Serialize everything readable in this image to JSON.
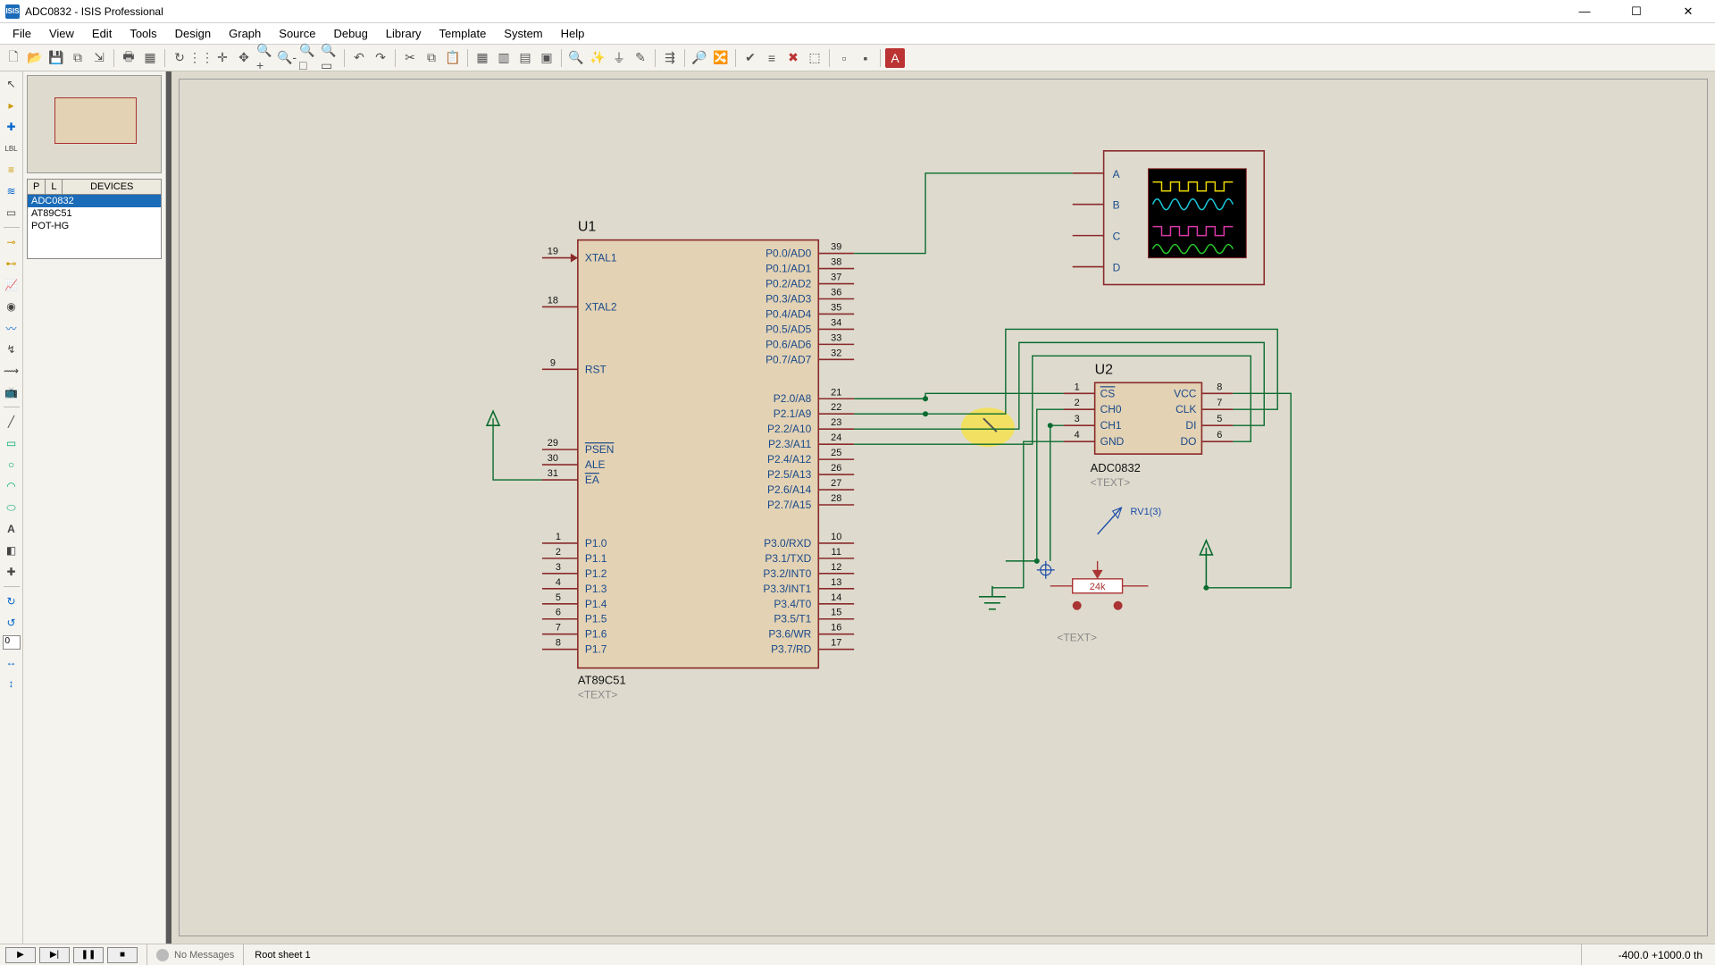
{
  "window": {
    "title": "ADC0832 - ISIS Professional"
  },
  "menu": [
    "File",
    "View",
    "Edit",
    "Tools",
    "Design",
    "Graph",
    "Source",
    "Debug",
    "Library",
    "Template",
    "System",
    "Help"
  ],
  "sidepanel": {
    "header": {
      "p": "P",
      "l": "L",
      "devices": "DEVICES"
    },
    "devices": [
      "ADC0832",
      "AT89C51",
      "POT-HG"
    ],
    "selected_index": 0
  },
  "schematic": {
    "u1": {
      "ref": "U1",
      "part": "AT89C51",
      "text_placeholder": "<TEXT>",
      "left_pins": [
        {
          "num": "19",
          "name": "XTAL1"
        },
        {
          "num": "18",
          "name": "XTAL2"
        },
        {
          "num": "9",
          "name": "RST"
        },
        {
          "num": "29",
          "name": "PSEN",
          "over": true
        },
        {
          "num": "30",
          "name": "ALE"
        },
        {
          "num": "31",
          "name": "EA",
          "over": true
        },
        {
          "num": "1",
          "name": "P1.0"
        },
        {
          "num": "2",
          "name": "P1.1"
        },
        {
          "num": "3",
          "name": "P1.2"
        },
        {
          "num": "4",
          "name": "P1.3"
        },
        {
          "num": "5",
          "name": "P1.4"
        },
        {
          "num": "6",
          "name": "P1.5"
        },
        {
          "num": "7",
          "name": "P1.6"
        },
        {
          "num": "8",
          "name": "P1.7"
        }
      ],
      "right_pins": [
        {
          "num": "39",
          "name": "P0.0/AD0"
        },
        {
          "num": "38",
          "name": "P0.1/AD1"
        },
        {
          "num": "37",
          "name": "P0.2/AD2"
        },
        {
          "num": "36",
          "name": "P0.3/AD3"
        },
        {
          "num": "35",
          "name": "P0.4/AD4"
        },
        {
          "num": "34",
          "name": "P0.5/AD5"
        },
        {
          "num": "33",
          "name": "P0.6/AD6"
        },
        {
          "num": "32",
          "name": "P0.7/AD7"
        },
        {
          "num": "21",
          "name": "P2.0/A8"
        },
        {
          "num": "22",
          "name": "P2.1/A9"
        },
        {
          "num": "23",
          "name": "P2.2/A10"
        },
        {
          "num": "24",
          "name": "P2.3/A11"
        },
        {
          "num": "25",
          "name": "P2.4/A12"
        },
        {
          "num": "26",
          "name": "P2.5/A13"
        },
        {
          "num": "27",
          "name": "P2.6/A14"
        },
        {
          "num": "28",
          "name": "P2.7/A15"
        },
        {
          "num": "10",
          "name": "P3.0/RXD"
        },
        {
          "num": "11",
          "name": "P3.1/TXD"
        },
        {
          "num": "12",
          "name": "P3.2/INT0",
          "over": "INT0"
        },
        {
          "num": "13",
          "name": "P3.3/INT1",
          "over": "INT1"
        },
        {
          "num": "14",
          "name": "P3.4/T0"
        },
        {
          "num": "15",
          "name": "P3.5/T1"
        },
        {
          "num": "16",
          "name": "P3.6/WR",
          "over": "WR"
        },
        {
          "num": "17",
          "name": "P3.7/RD",
          "over": "RD"
        }
      ]
    },
    "u2": {
      "ref": "U2",
      "part": "ADC0832",
      "text_placeholder": "<TEXT>",
      "left_pins": [
        {
          "num": "1",
          "name": "CS",
          "over": true
        },
        {
          "num": "2",
          "name": "CH0"
        },
        {
          "num": "3",
          "name": "CH1"
        },
        {
          "num": "4",
          "name": "GND"
        }
      ],
      "right_pins": [
        {
          "num": "8",
          "name": "VCC"
        },
        {
          "num": "7",
          "name": "CLK"
        },
        {
          "num": "5",
          "name": "DI"
        },
        {
          "num": "6",
          "name": "DO"
        }
      ]
    },
    "scope": {
      "channels": [
        "A",
        "B",
        "C",
        "D"
      ]
    },
    "pot": {
      "ref": "RV1(3)",
      "value": "24k",
      "text_placeholder": "<TEXT>"
    }
  },
  "status": {
    "messages": "No Messages",
    "sheet": "Root sheet 1",
    "coords": "-400.0   +1000.0    th"
  }
}
